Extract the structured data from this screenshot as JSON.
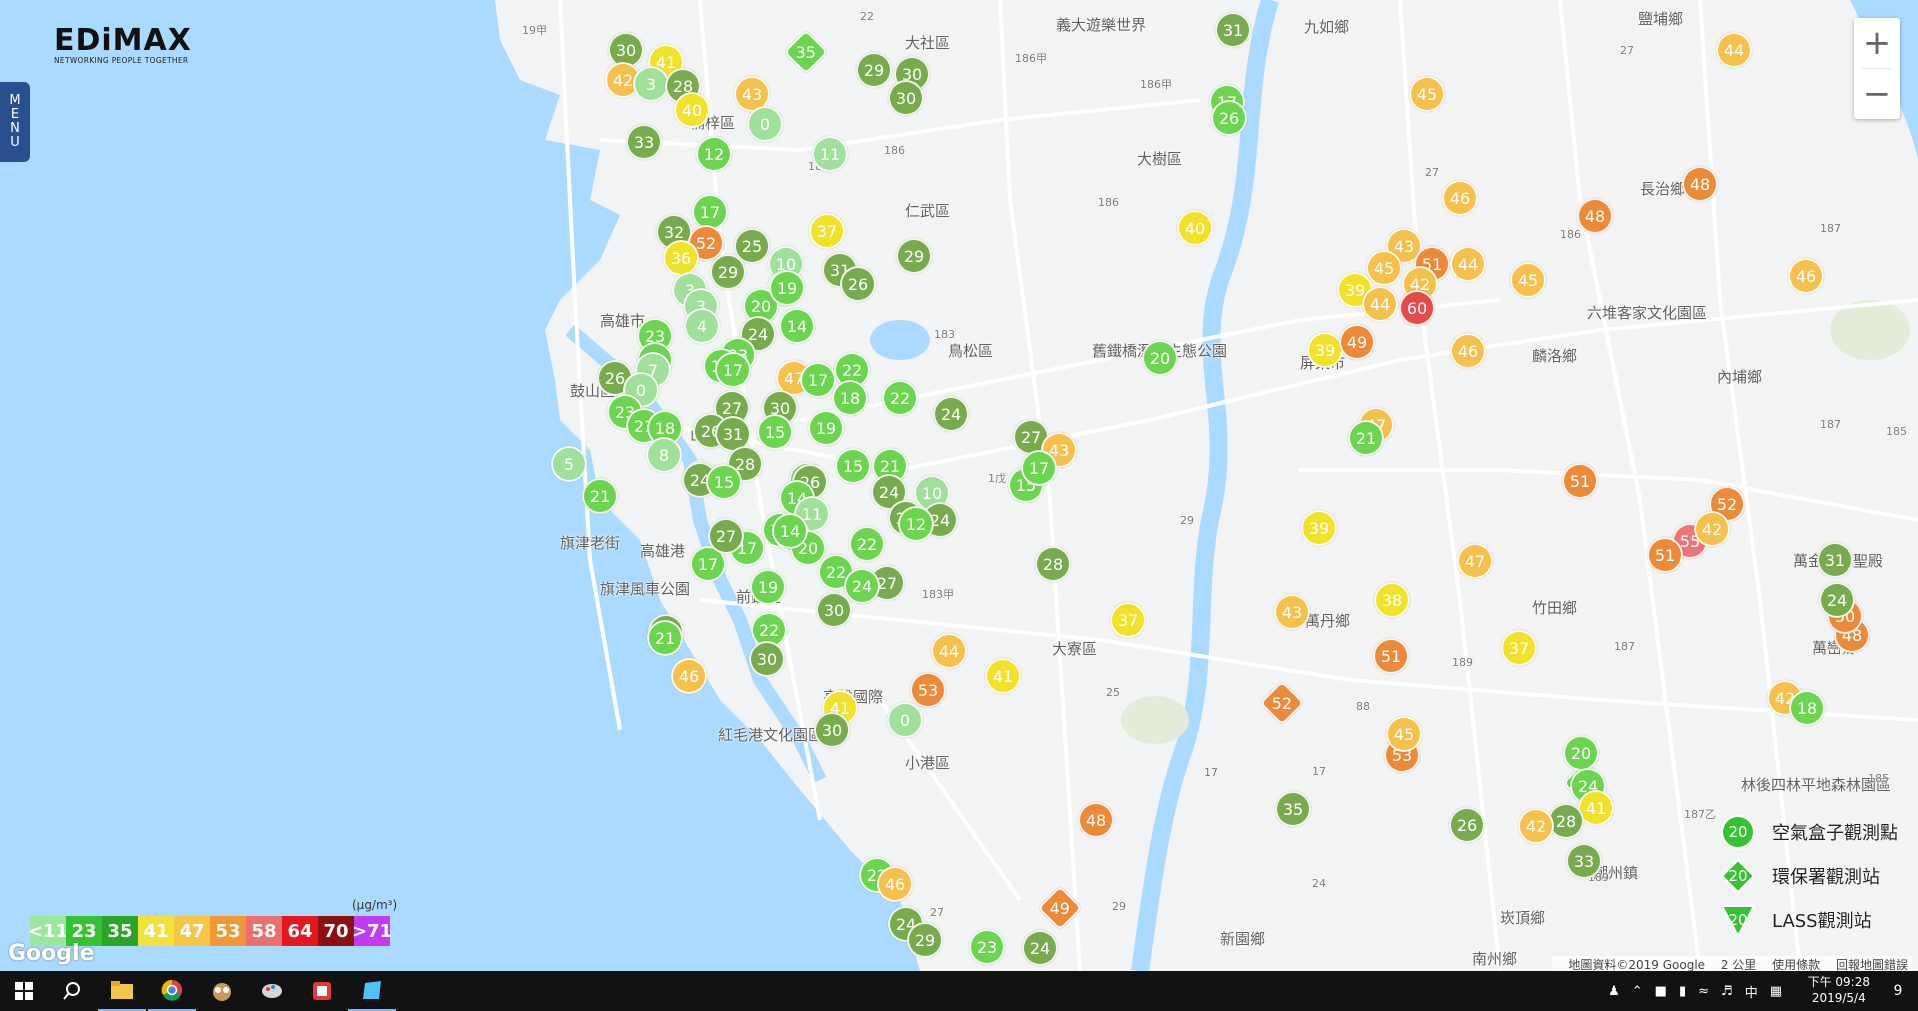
{
  "branding": {
    "logo_text": "EDiMAX",
    "tagline": "NETWORKING PEOPLE TOGETHER"
  },
  "menu": {
    "label_letters": [
      "M",
      "E",
      "N",
      "U"
    ]
  },
  "zoom": {
    "in_label": "+",
    "out_label": "−"
  },
  "colors": {
    "sea": "#aadaff",
    "land": "#f2f3f4",
    "river": "#aadaff",
    "park": "#e3ecd9",
    "level_11": "#9ce89a",
    "level_23": "#36c332",
    "level_35": "#2ba528",
    "level_41": "#f1e23a",
    "level_47": "#f6c644",
    "level_53": "#f19834",
    "level_58": "#ea6f6f",
    "level_64": "#e3171c",
    "level_70": "#8c1010",
    "level_71p": "#c13bf0",
    "marker_light_green": "#9fe09a",
    "marker_green": "#6cd54f",
    "marker_dark_green": "#77ab4d",
    "marker_yellow": "#f2e12b",
    "marker_light_orange": "#f5c04c",
    "marker_orange": "#ec8a39",
    "marker_red": "#e34a48",
    "marker_pink": "#ec7575"
  },
  "legend": {
    "unit": "(μg/m³)",
    "items": [
      {
        "label": "<11",
        "color": "#9ce89a"
      },
      {
        "label": "23",
        "color": "#36c332"
      },
      {
        "label": "35",
        "color": "#2ba528"
      },
      {
        "label": "41",
        "color": "#f1e23a"
      },
      {
        "label": "47",
        "color": "#f6c644"
      },
      {
        "label": "53",
        "color": "#f19834"
      },
      {
        "label": "58",
        "color": "#ea6f6f"
      },
      {
        "label": "64",
        "color": "#e3171c"
      },
      {
        "label": "70",
        "color": "#8c1010"
      },
      {
        "label": ">71",
        "color": "#c13bf0"
      }
    ]
  },
  "station_types": [
    {
      "name": "air-box",
      "label": "空氣盒子觀測點",
      "sample": "20",
      "icon": "circle-marker-icon",
      "color": "#36c332"
    },
    {
      "name": "epa",
      "label": "環保署觀測站",
      "sample": "20",
      "icon": "diamond-marker-icon",
      "color": "#36c332"
    },
    {
      "name": "lass",
      "label": "LASS觀測站",
      "sample": "20",
      "icon": "triangle-marker-icon",
      "color": "#36c332"
    }
  ],
  "places": [
    {
      "text": "大社區"
    },
    {
      "text": "仁武區"
    },
    {
      "text": "大樹區"
    },
    {
      "text": "義大遊樂世界"
    },
    {
      "text": "九如鄉"
    },
    {
      "text": "鹽埔鄉"
    },
    {
      "text": "長治鄉"
    },
    {
      "text": "六堆客家文化園區"
    },
    {
      "text": "麟洛鄉"
    },
    {
      "text": "內埔鄉"
    },
    {
      "text": "屏東市"
    },
    {
      "text": "舊鐵橋溼地生態公園"
    },
    {
      "text": "鳥松區"
    },
    {
      "text": "楠梓區"
    },
    {
      "text": "高雄市"
    },
    {
      "text": "鼓山區"
    },
    {
      "text": "旗津老街"
    },
    {
      "text": "旗津風車公園"
    },
    {
      "text": "前鎮區"
    },
    {
      "text": "高雄國際"
    },
    {
      "text": "紅毛港文化園區"
    },
    {
      "text": "小港區"
    },
    {
      "text": "大寮區"
    },
    {
      "text": "萬丹鄉"
    },
    {
      "text": "竹田鄉"
    },
    {
      "text": "萬巒鄉"
    },
    {
      "text": "萬金聖母聖殿"
    },
    {
      "text": "林後四林平地森林園區"
    },
    {
      "text": "潮州鎮"
    },
    {
      "text": "崁頂鄉"
    },
    {
      "text": "新園鄉"
    },
    {
      "text": "南州鄉"
    },
    {
      "text": "高雄港"
    },
    {
      "text": "山動物園"
    },
    {
      "text": "苓雅"
    }
  ],
  "road_labels": [
    "19甲",
    "22",
    "186甲",
    "186甲",
    "183",
    "186",
    "186",
    "183",
    "1戊",
    "29",
    "183甲",
    "27",
    "186",
    "187",
    "187",
    "185",
    "189",
    "187",
    "187乙",
    "185",
    "189",
    "88",
    "25",
    "29",
    "17",
    "27",
    "17",
    "24",
    "27"
  ],
  "markers": [
    {
      "v": "30",
      "c": "#77ab4d"
    },
    {
      "v": "41",
      "c": "#f2e12b"
    },
    {
      "v": "42",
      "c": "#f5c04c"
    },
    {
      "v": "3",
      "c": "#9fe09a"
    },
    {
      "v": "28",
      "c": "#77ab4d"
    },
    {
      "v": "40",
      "c": "#f2e12b"
    },
    {
      "v": "35",
      "c": "#6cd54f"
    },
    {
      "v": "43",
      "c": "#f5c04c"
    },
    {
      "v": "29",
      "c": "#77ab4d"
    },
    {
      "v": "30",
      "c": "#77ab4d"
    },
    {
      "v": "30",
      "c": "#77ab4d"
    },
    {
      "v": "0",
      "c": "#9fe09a"
    },
    {
      "v": "33",
      "c": "#77ab4d"
    },
    {
      "v": "12",
      "c": "#6cd54f"
    },
    {
      "v": "11",
      "c": "#9fe09a"
    },
    {
      "v": "31",
      "c": "#77ab4d"
    },
    {
      "v": "17",
      "c": "#6cd54f"
    },
    {
      "v": "26",
      "c": "#6cd54f"
    },
    {
      "v": "45",
      "c": "#f5c04c"
    },
    {
      "v": "44",
      "c": "#f5c04c"
    },
    {
      "v": "40",
      "c": "#f2e12b"
    },
    {
      "v": "46",
      "c": "#f5c04c"
    },
    {
      "v": "48",
      "c": "#ec8a39"
    },
    {
      "v": "48",
      "c": "#ec8a39"
    },
    {
      "v": "17",
      "c": "#6cd54f"
    },
    {
      "v": "32",
      "c": "#77ab4d"
    },
    {
      "v": "52",
      "c": "#ec8a39"
    },
    {
      "v": "36",
      "c": "#f2e12b"
    },
    {
      "v": "25",
      "c": "#77ab4d"
    },
    {
      "v": "29",
      "c": "#77ab4d"
    },
    {
      "v": "10",
      "c": "#9fe09a"
    },
    {
      "v": "19",
      "c": "#6cd54f"
    },
    {
      "v": "37",
      "c": "#f2e12b"
    },
    {
      "v": "31",
      "c": "#77ab4d"
    },
    {
      "v": "26",
      "c": "#77ab4d"
    },
    {
      "v": "29",
      "c": "#77ab4d"
    },
    {
      "v": "3",
      "c": "#9fe09a"
    },
    {
      "v": "3",
      "c": "#9fe09a"
    },
    {
      "v": "20",
      "c": "#6cd54f"
    },
    {
      "v": "19",
      "c": "#6cd54f"
    },
    {
      "v": "23",
      "c": "#6cd54f"
    },
    {
      "v": "4",
      "c": "#9fe09a"
    },
    {
      "v": "24",
      "c": "#77ab4d"
    },
    {
      "v": "14",
      "c": "#6cd54f"
    },
    {
      "v": "23",
      "c": "#6cd54f"
    },
    {
      "v": "18",
      "c": "#6cd54f"
    },
    {
      "v": "17",
      "c": "#6cd54f"
    },
    {
      "v": "23",
      "c": "#6cd54f"
    },
    {
      "v": "20",
      "c": "#6cd54f"
    },
    {
      "v": "43",
      "c": "#f5c04c"
    },
    {
      "v": "45",
      "c": "#f5c04c"
    },
    {
      "v": "51",
      "c": "#ec8a39"
    },
    {
      "v": "44",
      "c": "#f5c04c"
    },
    {
      "v": "42",
      "c": "#f5c04c"
    },
    {
      "v": "39",
      "c": "#f2e12b"
    },
    {
      "v": "44",
      "c": "#f5c04c"
    },
    {
      "v": "60",
      "c": "#e34a48"
    },
    {
      "v": "45",
      "c": "#f5c04c"
    },
    {
      "v": "46",
      "c": "#f5c04c"
    },
    {
      "v": "39",
      "c": "#f2e12b"
    },
    {
      "v": "49",
      "c": "#ec8a39"
    },
    {
      "v": "46",
      "c": "#f5c04c"
    },
    {
      "v": "26",
      "c": "#77ab4d"
    },
    {
      "v": "7",
      "c": "#9fe09a"
    },
    {
      "v": "0",
      "c": "#9fe09a"
    },
    {
      "v": "47",
      "c": "#f5c04c"
    },
    {
      "v": "17",
      "c": "#6cd54f"
    },
    {
      "v": "22",
      "c": "#6cd54f"
    },
    {
      "v": "18",
      "c": "#6cd54f"
    },
    {
      "v": "22",
      "c": "#6cd54f"
    },
    {
      "v": "27",
      "c": "#77ab4d"
    },
    {
      "v": "30",
      "c": "#77ab4d"
    },
    {
      "v": "24",
      "c": "#77ab4d"
    },
    {
      "v": "23",
      "c": "#6cd54f"
    },
    {
      "v": "21",
      "c": "#6cd54f"
    },
    {
      "v": "18",
      "c": "#6cd54f"
    },
    {
      "v": "15",
      "c": "#6cd54f"
    },
    {
      "v": "26",
      "c": "#77ab4d"
    },
    {
      "v": "31",
      "c": "#77ab4d"
    },
    {
      "v": "19",
      "c": "#6cd54f"
    },
    {
      "v": "27",
      "c": "#77ab4d"
    },
    {
      "v": "43",
      "c": "#f5c04c"
    },
    {
      "v": "47",
      "c": "#f5c04c"
    },
    {
      "v": "21",
      "c": "#6cd54f"
    },
    {
      "v": "8",
      "c": "#9fe09a"
    },
    {
      "v": "5",
      "c": "#9fe09a"
    },
    {
      "v": "18",
      "c": "#6cd54f"
    },
    {
      "v": "28",
      "c": "#77ab4d"
    },
    {
      "v": "24",
      "c": "#77ab4d"
    },
    {
      "v": "15",
      "c": "#6cd54f"
    },
    {
      "v": "19",
      "c": "#6cd54f"
    },
    {
      "v": "15",
      "c": "#6cd54f"
    },
    {
      "v": "21",
      "c": "#6cd54f"
    },
    {
      "v": "24",
      "c": "#77ab4d"
    },
    {
      "v": "26",
      "c": "#77ab4d"
    },
    {
      "v": "10",
      "c": "#9fe09a"
    },
    {
      "v": "24",
      "c": "#77ab4d"
    },
    {
      "v": "14",
      "c": "#6cd54f"
    },
    {
      "v": "27",
      "c": "#77ab4d"
    },
    {
      "v": "12",
      "c": "#6cd54f"
    },
    {
      "v": "11",
      "c": "#9fe09a"
    },
    {
      "v": "15",
      "c": "#6cd54f"
    },
    {
      "v": "14",
      "c": "#6cd54f"
    },
    {
      "v": "17",
      "c": "#6cd54f"
    },
    {
      "v": "20",
      "c": "#6cd54f"
    },
    {
      "v": "22",
      "c": "#6cd54f"
    },
    {
      "v": "51",
      "c": "#ec8a39"
    },
    {
      "v": "52",
      "c": "#ec8a39"
    },
    {
      "v": "55",
      "c": "#ec7575"
    },
    {
      "v": "42",
      "c": "#f5c04c"
    },
    {
      "v": "51",
      "c": "#ec8a39"
    },
    {
      "v": "31",
      "c": "#77ab4d"
    },
    {
      "v": "39",
      "c": "#f2e12b"
    },
    {
      "v": "47",
      "c": "#f5c04c"
    },
    {
      "v": "38",
      "c": "#f2e12b"
    },
    {
      "v": "43",
      "c": "#f5c04c"
    },
    {
      "v": "51",
      "c": "#ec8a39"
    },
    {
      "v": "37",
      "c": "#f2e12b"
    },
    {
      "v": "28",
      "c": "#77ab4d"
    },
    {
      "v": "15",
      "c": "#6cd54f"
    },
    {
      "v": "17",
      "c": "#6cd54f"
    },
    {
      "v": "14",
      "c": "#6cd54f"
    },
    {
      "v": "17",
      "c": "#6cd54f"
    },
    {
      "v": "21",
      "c": "#6cd54f"
    },
    {
      "v": "27",
      "c": "#77ab4d"
    },
    {
      "v": "22",
      "c": "#6cd54f"
    },
    {
      "v": "27",
      "c": "#77ab4d"
    },
    {
      "v": "24",
      "c": "#6cd54f"
    },
    {
      "v": "19",
      "c": "#6cd54f"
    },
    {
      "v": "30",
      "c": "#77ab4d"
    },
    {
      "v": "33",
      "c": "#77ab4d"
    },
    {
      "v": "22",
      "c": "#6cd54f"
    },
    {
      "v": "30",
      "c": "#77ab4d"
    },
    {
      "v": "21",
      "c": "#6cd54f"
    },
    {
      "v": "46",
      "c": "#f5c04c"
    },
    {
      "v": "44",
      "c": "#f5c04c"
    },
    {
      "v": "41",
      "c": "#f2e12b"
    },
    {
      "v": "53",
      "c": "#ec8a39"
    },
    {
      "v": "48",
      "c": "#ec8a39"
    },
    {
      "v": "41",
      "c": "#f2e12b"
    },
    {
      "v": "0",
      "c": "#9fe09a"
    },
    {
      "v": "30",
      "c": "#77ab4d"
    },
    {
      "v": "53",
      "c": "#ec8a39"
    },
    {
      "v": "50",
      "c": "#ec8a39"
    },
    {
      "v": "37",
      "c": "#f2e12b"
    },
    {
      "v": "52",
      "c": "#ec8a39"
    },
    {
      "v": "45",
      "c": "#f5c04c"
    },
    {
      "v": "42",
      "c": "#f5c04c"
    },
    {
      "v": "24",
      "c": "#77ab4d"
    },
    {
      "v": "18",
      "c": "#6cd54f"
    },
    {
      "v": "25",
      "c": "#6cd54f"
    },
    {
      "v": "20",
      "c": "#6cd54f"
    },
    {
      "v": "24",
      "c": "#6cd54f"
    },
    {
      "v": "41",
      "c": "#f2e12b"
    },
    {
      "v": "28",
      "c": "#77ab4d"
    },
    {
      "v": "42",
      "c": "#f5c04c"
    },
    {
      "v": "33",
      "c": "#77ab4d"
    },
    {
      "v": "26",
      "c": "#77ab4d"
    },
    {
      "v": "35",
      "c": "#77ab4d"
    },
    {
      "v": "48",
      "c": "#ec8a39"
    },
    {
      "v": "49",
      "c": "#ec8a39"
    },
    {
      "v": "22",
      "c": "#6cd54f"
    },
    {
      "v": "46",
      "c": "#f5c04c"
    },
    {
      "v": "24",
      "c": "#77ab4d"
    },
    {
      "v": "29",
      "c": "#77ab4d"
    },
    {
      "v": "23",
      "c": "#6cd54f"
    },
    {
      "v": "24",
      "c": "#77ab4d"
    }
  ],
  "attribution": {
    "data": "地圖資料©2019 Google",
    "scale": "2 公里",
    "terms": "使用條款",
    "report": "回報地圖錯誤"
  },
  "google_logo": "Google",
  "taskbar": {
    "clock_time": "下午 09:28",
    "clock_date": "2019/5/4",
    "ime": "中",
    "notifications": "9"
  }
}
